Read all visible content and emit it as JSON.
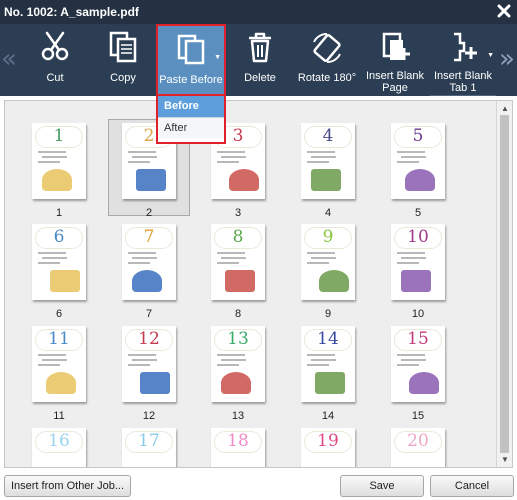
{
  "window": {
    "title": "No. 1002: A_sample.pdf"
  },
  "toolbar": {
    "buttons": [
      {
        "label": "Cut",
        "icon": "scissors-icon"
      },
      {
        "label": "Copy",
        "icon": "copy-icon"
      },
      {
        "label": "Paste Before",
        "icon": "paste-icon"
      },
      {
        "label": "Delete",
        "icon": "trash-icon"
      },
      {
        "label": "Rotate 180°",
        "icon": "rotate-icon"
      },
      {
        "label": "Insert Blank Page",
        "icon": "insert-page-icon"
      },
      {
        "label": "Insert Blank Tab 1",
        "icon": "insert-tab-icon"
      }
    ],
    "paste_menu": {
      "options": [
        "Before",
        "After"
      ],
      "selected": "Before"
    }
  },
  "pages": [
    {
      "label": "1",
      "color": "#4a9a66"
    },
    {
      "label": "2",
      "color": "#d9a441"
    },
    {
      "label": "3",
      "color": "#c43a4f"
    },
    {
      "label": "4",
      "color": "#4a4a8a"
    },
    {
      "label": "5",
      "color": "#6a3a8a"
    },
    {
      "label": "6",
      "color": "#4a8ac4"
    },
    {
      "label": "7",
      "color": "#e0a030"
    },
    {
      "label": "8",
      "color": "#5aa84a"
    },
    {
      "label": "9",
      "color": "#8ac43a"
    },
    {
      "label": "10",
      "color": "#a03a8a"
    },
    {
      "label": "11",
      "color": "#4a8ac4"
    },
    {
      "label": "12",
      "color": "#c43a4f"
    },
    {
      "label": "13",
      "color": "#3aaa6a"
    },
    {
      "label": "14",
      "color": "#3a4aa0"
    },
    {
      "label": "15",
      "color": "#c43a7a"
    },
    {
      "label": "16",
      "color": "#9ad4f0"
    },
    {
      "label": "17",
      "color": "#8acbe8"
    },
    {
      "label": "18",
      "color": "#f08ac8"
    },
    {
      "label": "19",
      "color": "#e04a8a"
    },
    {
      "label": "20",
      "color": "#f0a8c8"
    }
  ],
  "selected_page": "2",
  "footer": {
    "insert_from_job": "Insert from Other Job...",
    "save": "Save",
    "cancel": "Cancel"
  }
}
